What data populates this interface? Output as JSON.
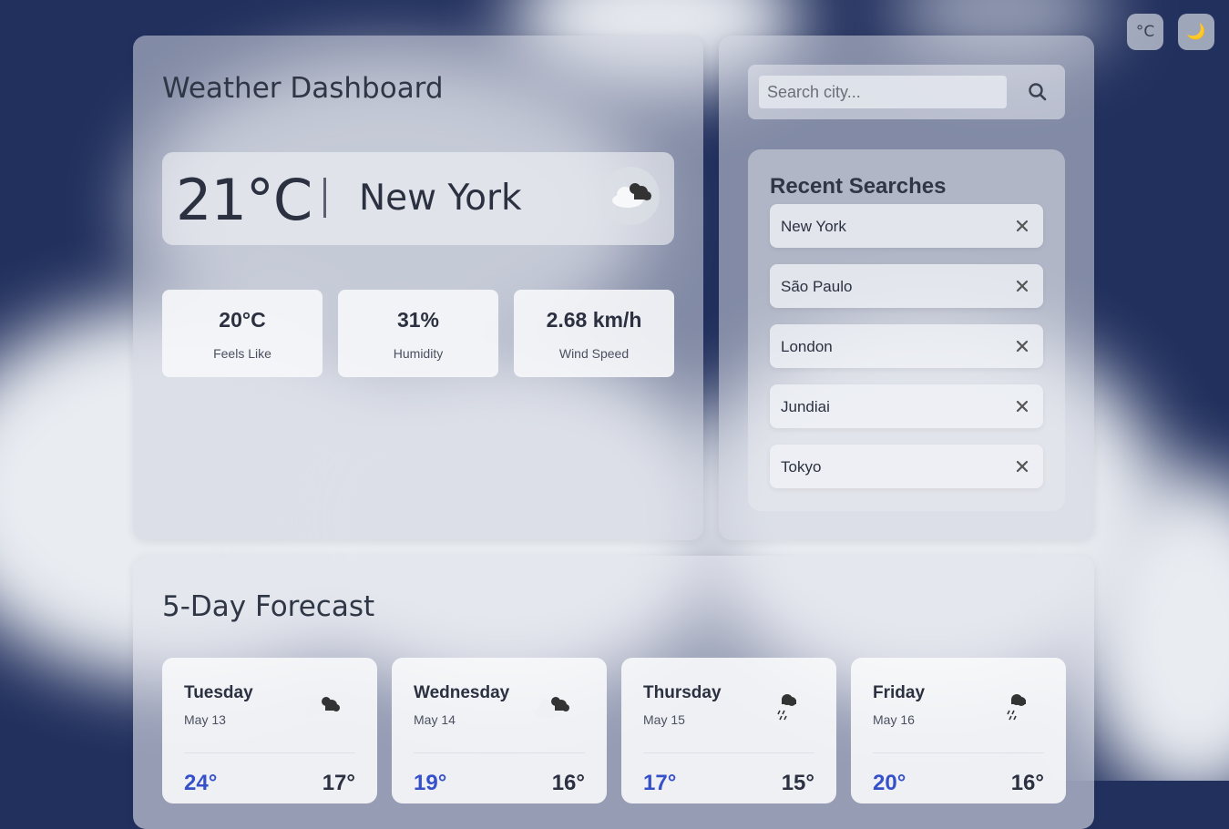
{
  "header": {
    "unit_toggle": "°C",
    "theme_toggle": "🌙"
  },
  "dashboard": {
    "title": "Weather Dashboard",
    "current": {
      "temperature": "21°C",
      "city": "New York",
      "icon": "cloudy-icon"
    },
    "stats": [
      {
        "value": "20°C",
        "label": "Feels Like"
      },
      {
        "value": "31%",
        "label": "Humidity"
      },
      {
        "value": "2.68 km/h",
        "label": "Wind Speed"
      }
    ]
  },
  "search": {
    "placeholder": "Search city...",
    "icon": "search-icon"
  },
  "recent": {
    "title": "Recent Searches",
    "items": [
      {
        "name": "New York"
      },
      {
        "name": "São Paulo"
      },
      {
        "name": "London"
      },
      {
        "name": "Jundiai"
      },
      {
        "name": "Tokyo"
      }
    ],
    "remove_icon": "close-icon"
  },
  "forecast": {
    "title": "5-Day Forecast",
    "days": [
      {
        "day": "Tuesday",
        "date": "May 13",
        "icon": "cloudy-icon",
        "high": "24°",
        "low": "17°"
      },
      {
        "day": "Wednesday",
        "date": "May 14",
        "icon": "cloudy-icon",
        "high": "19°",
        "low": "16°"
      },
      {
        "day": "Thursday",
        "date": "May 15",
        "icon": "rain-icon",
        "high": "17°",
        "low": "15°"
      },
      {
        "day": "Friday",
        "date": "May 16",
        "icon": "rain-icon",
        "high": "20°",
        "low": "16°"
      }
    ]
  },
  "colors": {
    "sky": "#22305e",
    "high_temp": "#3550c8",
    "text": "#2b3140"
  }
}
